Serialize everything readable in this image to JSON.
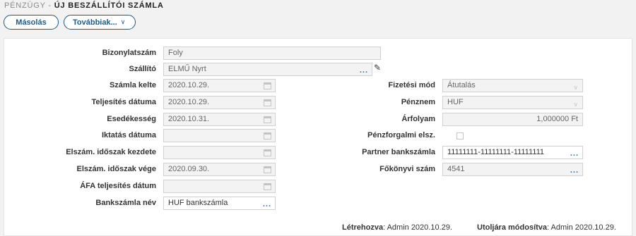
{
  "breadcrumb": {
    "section": "Pénzügy - ",
    "page": "Új beszállítói számla"
  },
  "toolbar": {
    "copy_label": "Másolás",
    "more_label": "Továbbiak...",
    "more_chevron": "∨"
  },
  "form": {
    "document_number": {
      "label": "Bizonylatszám",
      "value": "Foly"
    },
    "supplier": {
      "label": "Szállító",
      "value": "ELMŰ Nyrt"
    },
    "invoice_date": {
      "label": "Számla kelte",
      "value": "2020.10.29."
    },
    "completion_date": {
      "label": "Teljesítés dátuma",
      "value": "2020.10.29."
    },
    "due_date": {
      "label": "Esedékesség",
      "value": "2020.10.31."
    },
    "filing_date": {
      "label": "Iktatás dátuma",
      "value": ""
    },
    "period_start": {
      "label": "Elszám. időszak kezdete",
      "value": ""
    },
    "period_end": {
      "label": "Elszám. időszak vége",
      "value": "2020.09.30."
    },
    "vat_date": {
      "label": "ÁFA teljesítés dátum",
      "value": ""
    },
    "bank_account_name": {
      "label": "Bankszámla név",
      "value": "HUF bankszámla"
    },
    "payment_method": {
      "label": "Fizetési mód",
      "value": "Átutalás"
    },
    "currency": {
      "label": "Pénznem",
      "value": "HUF"
    },
    "exchange_rate": {
      "label": "Árfolyam",
      "value": "1,000000 Ft"
    },
    "cash_accounting": {
      "label": "Pénzforgalmi elsz.",
      "checked": false
    },
    "partner_bank_account": {
      "label": "Partner bankszámla",
      "value": "11111111-11111111-11111111"
    },
    "ledger_number": {
      "label": "Főkönyvi szám",
      "value": "4541"
    }
  },
  "footer": {
    "created_label": "Létrehozva",
    "created_value": ": Admin 2020.10.29.",
    "modified_label": "Utoljára módosítva",
    "modified_value": ": Admin 2020.10.29."
  },
  "icons": {
    "ellipsis": "...",
    "edit": "✎",
    "dropdown": "∨"
  },
  "colors": {
    "accent": "#1f5a86",
    "field_bg": "#f3f3f3",
    "link": "#2f6da3"
  }
}
